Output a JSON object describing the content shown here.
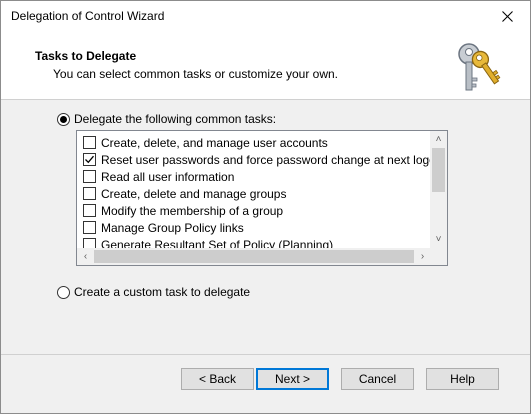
{
  "window": {
    "title": "Delegation of Control Wizard"
  },
  "header": {
    "title": "Tasks to Delegate",
    "subtitle": "You can select common tasks or customize your own.",
    "icon": "keys-icon"
  },
  "options": {
    "common": {
      "label": "Delegate the following common tasks:",
      "selected": true
    },
    "custom": {
      "label": "Create a custom task to delegate",
      "selected": false
    }
  },
  "tasks": [
    {
      "label": "Create, delete, and manage user accounts",
      "checked": false
    },
    {
      "label": "Reset user passwords and force password change at next logon",
      "checked": true
    },
    {
      "label": "Read all user information",
      "checked": false
    },
    {
      "label": "Create, delete and manage groups",
      "checked": false
    },
    {
      "label": "Modify the membership of a group",
      "checked": false
    },
    {
      "label": "Manage Group Policy links",
      "checked": false
    },
    {
      "label": "Generate Resultant Set of Policy (Planning)",
      "checked": false
    }
  ],
  "buttons": {
    "back": "< Back",
    "next": "Next >",
    "cancel": "Cancel",
    "help": "Help"
  }
}
